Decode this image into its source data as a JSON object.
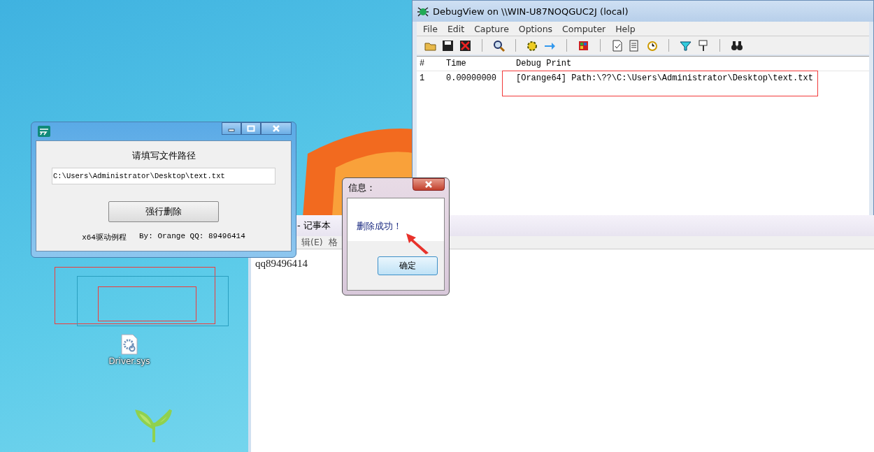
{
  "desktop": {
    "icons": [
      {
        "label": "Driver.sys"
      }
    ]
  },
  "debugview": {
    "title": "DebugView on \\\\WIN-U87NOQGUC2J (local)",
    "menu": [
      "File",
      "Edit",
      "Capture",
      "Options",
      "Computer",
      "Help"
    ],
    "columns": [
      "#",
      "Time",
      "Debug Print"
    ],
    "rows": [
      {
        "cells": [
          "1",
          "0.00000000",
          "[Orange64] Path:\\??\\C:\\Users\\Administrator\\Desktop\\text.txt"
        ]
      }
    ]
  },
  "notepad": {
    "title": "- 记事本",
    "menu": [
      "辑(E)",
      "格"
    ],
    "content": "qq89496414"
  },
  "tool_window": {
    "heading": "请填写文件路径",
    "path_field": {
      "value": "C:\\Users\\Administrator\\Desktop\\text.txt"
    },
    "button": "强行删除",
    "caption": "x64驱动例程",
    "credits": "By: Orange QQ: 89496414"
  },
  "message_box": {
    "title": "信息：",
    "message": "删除成功！",
    "button": "确定"
  }
}
